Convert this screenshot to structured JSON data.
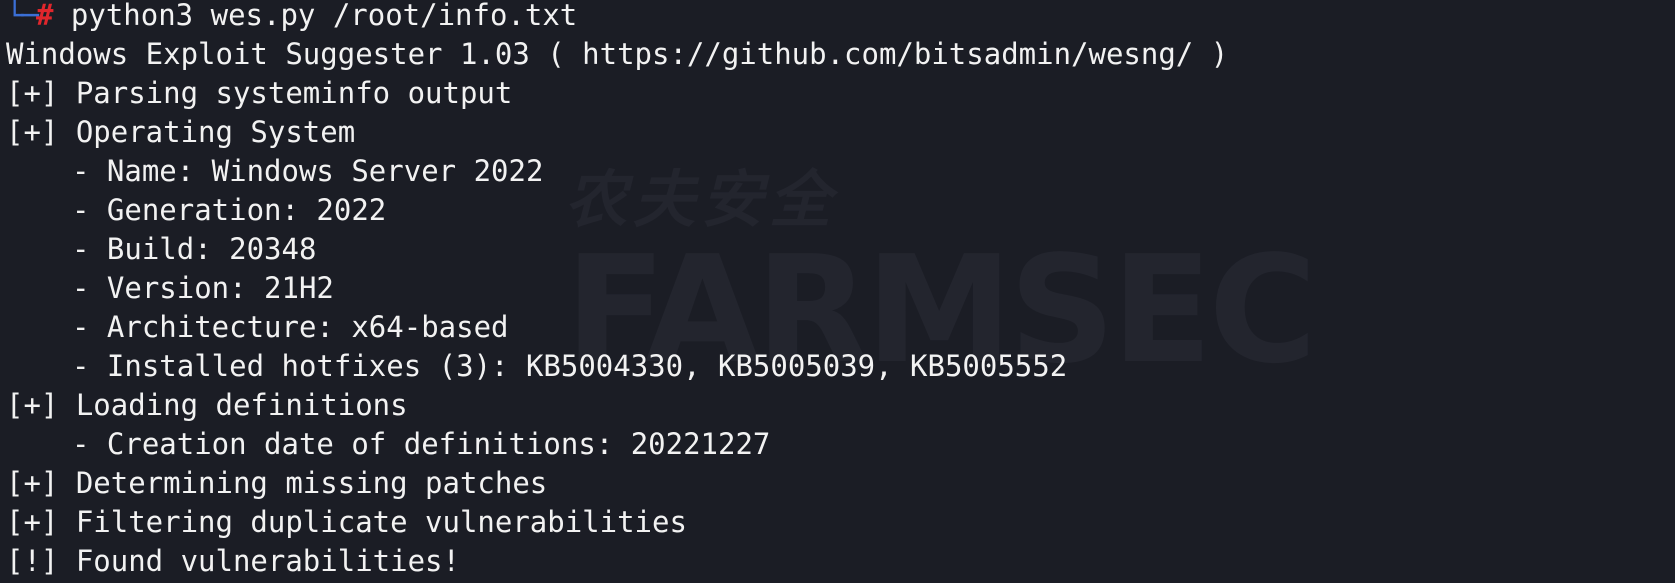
{
  "colors": {
    "background": "#1b1d25",
    "text": "#f2f2f2",
    "prompt_corner": "#3b6fd6",
    "prompt_hash": "#e0262c"
  },
  "prompt": {
    "corner": "└─",
    "symbol": "#",
    "command": " python3 wes.py /root/info.txt"
  },
  "output": {
    "banner": "Windows Exploit Suggester 1.03 ( https://github.com/bitsadmin/wesng/ )",
    "parsing": "[+] Parsing systeminfo output",
    "os_header": "[+] Operating System",
    "os_name": "- Name: Windows Server 2022",
    "os_generation": "- Generation: 2022",
    "os_build": "- Build: 20348",
    "os_version": "- Version: 21H2",
    "os_arch": "- Architecture: x64-based",
    "os_hotfixes": "- Installed hotfixes (3): KB5004330, KB5005039, KB5005552",
    "loading": "[+] Loading definitions",
    "definitions_date": "- Creation date of definitions: 20221227",
    "determining": "[+] Determining missing patches",
    "filtering": "[+] Filtering duplicate vulnerabilities",
    "found": "[!] Found vulnerabilities!"
  },
  "watermark": {
    "sub": "农夫安全",
    "main": "FARMSEC"
  }
}
